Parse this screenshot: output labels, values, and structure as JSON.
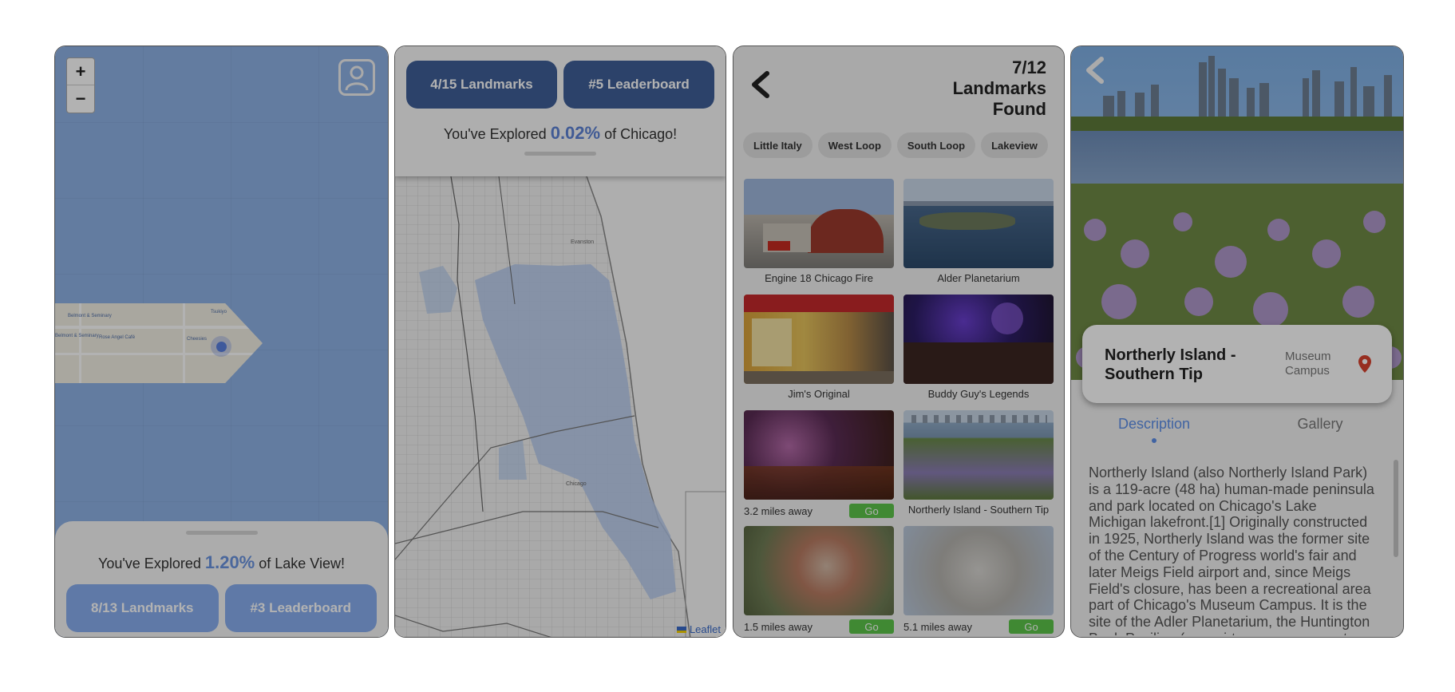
{
  "screen1": {
    "zoom_in": "+",
    "zoom_out": "−",
    "map_labels": [
      "Belmont & Seminary",
      "Belmont & Seminary",
      "Rose Angel Café",
      "Cheesies",
      "Tsukiyo"
    ],
    "explored_prefix": "You've Explored ",
    "explored_pct": "1.20%",
    "explored_suffix": " of Lake View!",
    "landmarks_button": "8/13 Landmarks",
    "leaderboard_button": "#3 Leaderboard",
    "colors": {
      "map_water": "#8fb2e6",
      "button_light": "#89aef0"
    }
  },
  "screen2": {
    "landmarks_button": "4/15 Landmarks",
    "leaderboard_button": "#5 Leaderboard",
    "explored_prefix": "You've Explored ",
    "explored_pct": "0.02%",
    "explored_suffix": " of Chicago!",
    "map_labels": [
      "Evanston",
      "Chicago"
    ],
    "attribution": "Leaflet",
    "colors": {
      "button_dark": "#3f5f98",
      "explored_region": "#9fbce8"
    }
  },
  "screen3": {
    "found_line1": "7/12",
    "found_line2": "Landmarks",
    "found_line3": "Found",
    "chips": [
      "Little Italy",
      "West Loop",
      "South Loop",
      "Lakeview"
    ],
    "cards": [
      {
        "caption": "Engine 18 Chicago Fire",
        "distance": "",
        "go": ""
      },
      {
        "caption": "Alder Planetarium",
        "distance": "",
        "go": ""
      },
      {
        "caption": "Jim's Original",
        "distance": "",
        "go": ""
      },
      {
        "caption": "Buddy Guy's Legends",
        "distance": "",
        "go": ""
      },
      {
        "caption": "",
        "distance": "3.2 miles away",
        "go": "Go"
      },
      {
        "caption": "Northerly Island - Southern Tip",
        "distance": "",
        "go": ""
      },
      {
        "caption": "",
        "distance": "1.5 miles away",
        "go": "Go"
      },
      {
        "caption": "",
        "distance": "5.1 miles away",
        "go": "Go"
      }
    ],
    "colors": {
      "go_button": "#5cc44a"
    }
  },
  "screen4": {
    "title": "Northerly Island - Southern Tip",
    "area": "Museum Campus",
    "tab_description": "Description",
    "tab_gallery": "Gallery",
    "description": "Northerly Island (also Northerly Island Park) is a 119-acre (48 ha) human-made peninsula and park located on Chicago's Lake Michigan lakefront.[1] Originally constructed in 1925, Northerly Island was the former site of the Century of Progress world's fair and later Meigs Field airport and, since Meigs Field's closure, has been a recreational area part of Chicago's Museum Campus. It is the site of the Adler Planetarium, the Huntington Bank Pavilion (a semi-temporary concert",
    "colors": {
      "tab_active": "#5c8fe8",
      "pin": "#d9432f"
    }
  }
}
